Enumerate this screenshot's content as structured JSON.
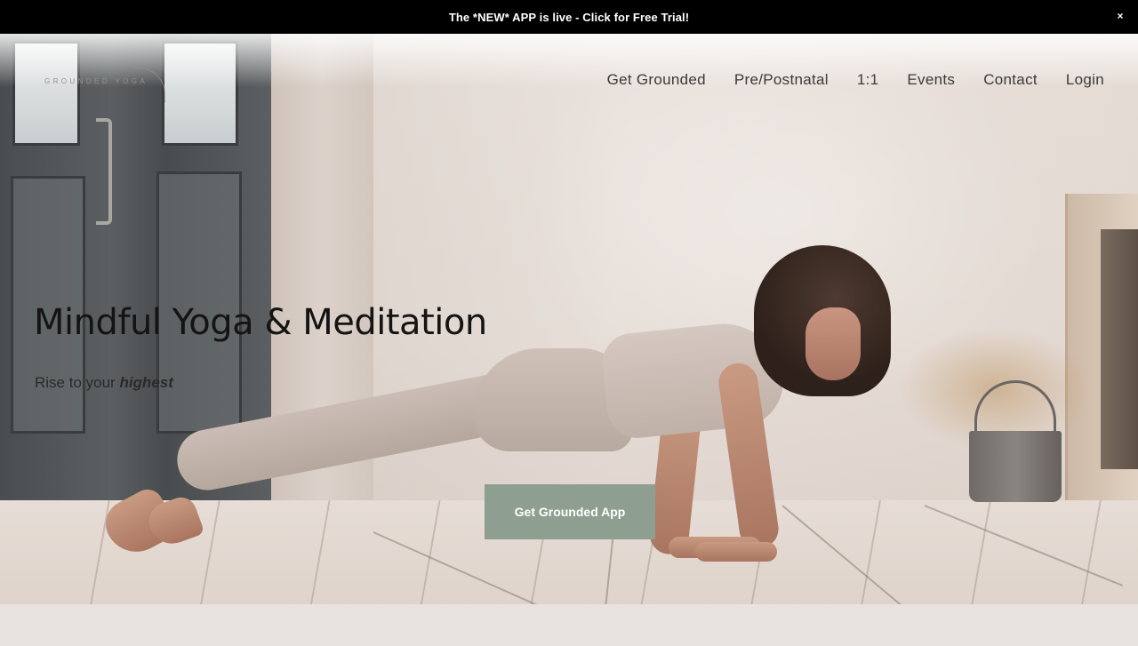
{
  "announcement": {
    "text": "The *NEW* APP is live - Click for Free Trial!",
    "close_label": "×"
  },
  "header": {
    "logo_text": "GROUNDED YOGA",
    "nav": [
      {
        "label": "Get Grounded"
      },
      {
        "label": "Pre/Postnatal"
      },
      {
        "label": "1:1"
      },
      {
        "label": "Events"
      },
      {
        "label": "Contact"
      },
      {
        "label": "Login"
      }
    ]
  },
  "hero": {
    "title": "Mindful Yoga & Meditation",
    "subtitle_prefix": "Rise to your ",
    "subtitle_emphasis": "highest",
    "cta_label": "Get Grounded App",
    "cta_color": "#8e9e91"
  },
  "colors": {
    "announcement_bg": "#000000",
    "page_bg": "#e8e3df",
    "nav_text": "#3a3a3a"
  }
}
